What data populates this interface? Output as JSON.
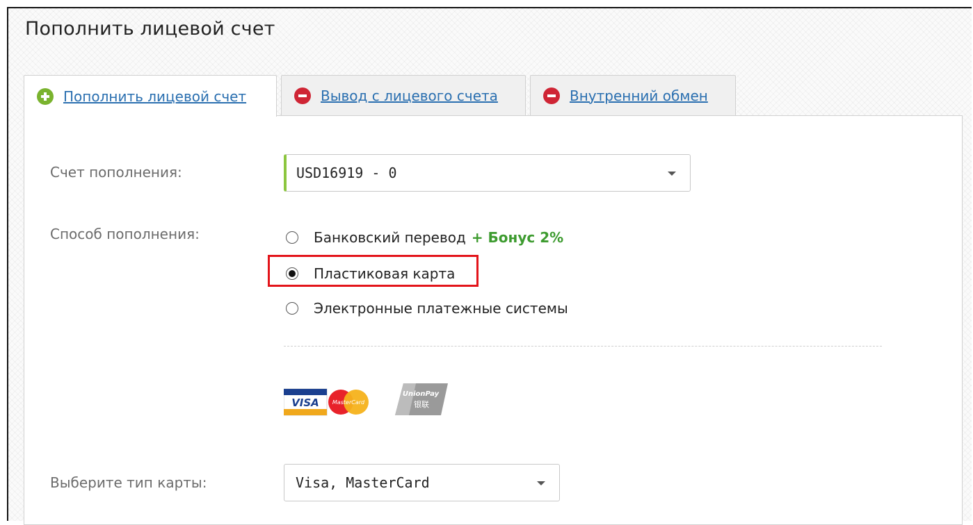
{
  "page": {
    "title": "Пополнить лицевой счет"
  },
  "tabs": [
    {
      "label": "Пополнить лицевой счет",
      "icon": "plus-circle-icon",
      "active": true
    },
    {
      "label": "Вывод с лицевого счета",
      "icon": "minus-circle-icon",
      "active": false
    },
    {
      "label": "Внутренний обмен",
      "icon": "minus-circle-icon",
      "active": false
    }
  ],
  "form": {
    "account_label": "Счет пополнения:",
    "account_value": "USD16919 - 0",
    "method_label": "Способ пополнения:",
    "methods": [
      {
        "label": "Банковский перевод",
        "bonus": "+ Бонус 2%",
        "selected": false
      },
      {
        "label": "Пластиковая карта",
        "selected": true
      },
      {
        "label": "Электронные платежные системы",
        "selected": false
      }
    ],
    "card_type_label": "Выберите тип карты:",
    "card_type_value": "Visa, MasterCard"
  },
  "logos": {
    "visa": "VISA",
    "mastercard": "MasterCard",
    "unionpay": "UnionPay",
    "unionpay_cn": "银联"
  },
  "colors": {
    "link": "#2a6fb0",
    "plus_icon": "#7ab32e",
    "minus_icon": "#cf2535",
    "bonus": "#3d9b2f",
    "highlight": "#e3141a",
    "select_accent": "#8cc63f"
  }
}
